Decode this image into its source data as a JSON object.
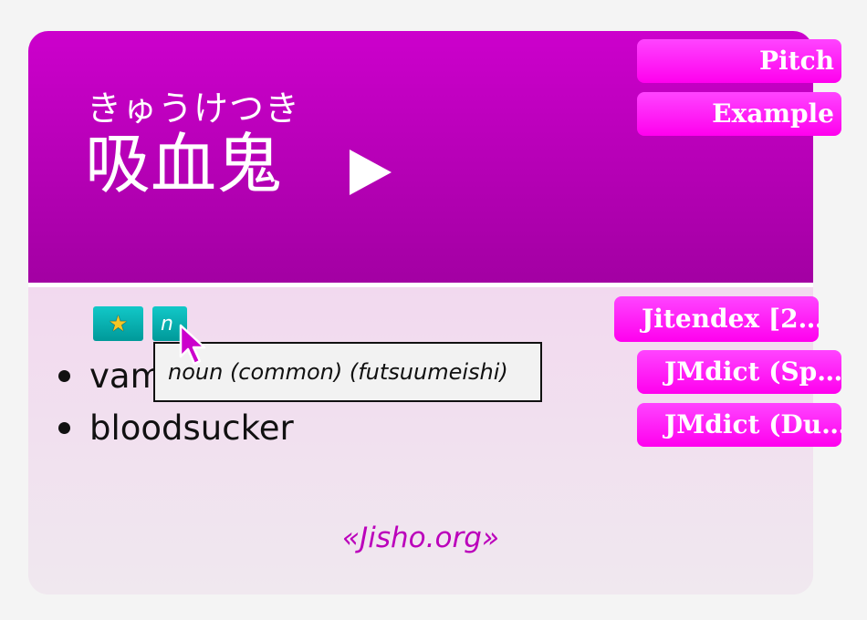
{
  "entry": {
    "reading": "きゅうけつき",
    "expression": "吸血鬼"
  },
  "tags": {
    "star_icon": "star-icon",
    "pos_label": "n"
  },
  "tooltip": {
    "text": "noun (common) (futsuumeishi)"
  },
  "definitions": [
    "vam",
    "bloodsucker"
  ],
  "source_link": "«Jisho.org»",
  "side_buttons": {
    "pitch": "Pitch",
    "example": "Example",
    "jitendex": "Jitendex [2…",
    "jmdict_sp": "JMdict (Sp…",
    "jmdict_du": "JMdict (Du…"
  },
  "colors": {
    "header": "#cc00cc",
    "tag": "#00aaaa",
    "button": "#ff22ff",
    "link": "#bb00bb"
  }
}
